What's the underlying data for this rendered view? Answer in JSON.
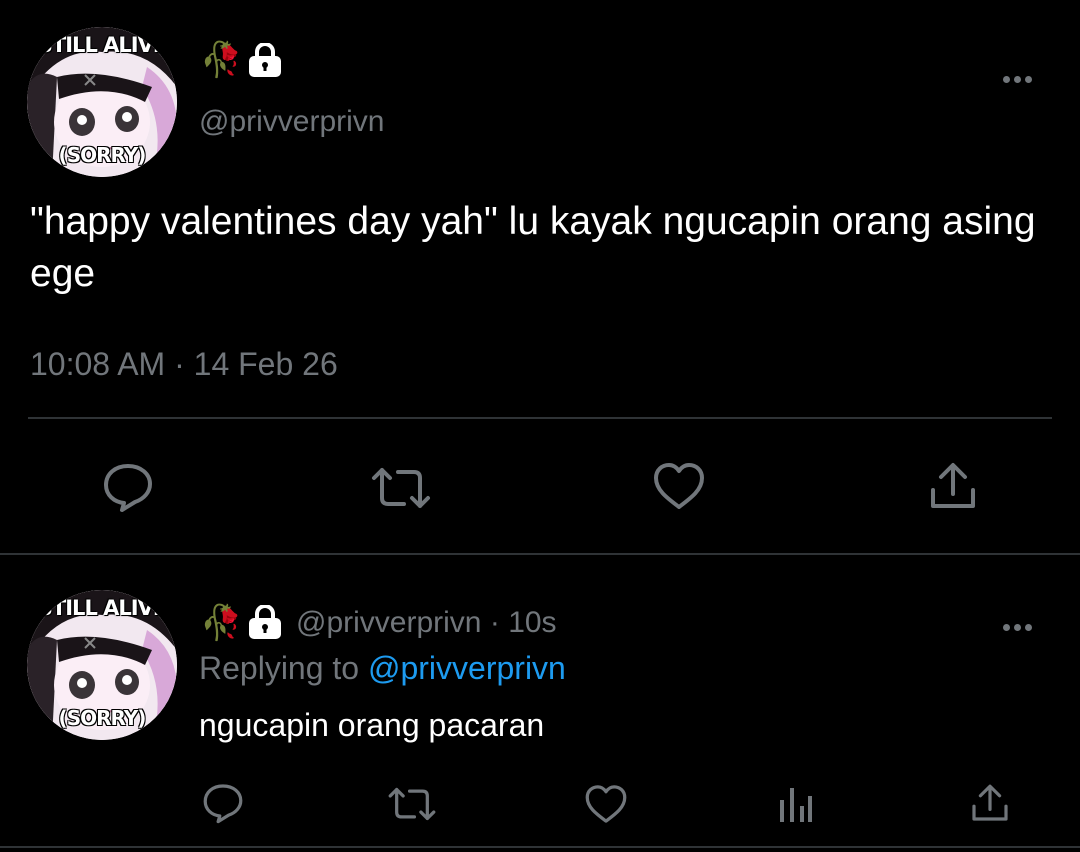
{
  "main_tweet": {
    "avatar": {
      "top_text": "STILL ALIVE",
      "bottom_text": "(SORRY)"
    },
    "emoji": "🥀",
    "handle": "@privverprivn",
    "text": "\"happy valentines day yah\" lu kayak ngucapin orang asing ege",
    "time": "10:08 AM",
    "separator": "·",
    "date": "14 Feb 26",
    "actions": [
      "reply-icon",
      "retweet-icon",
      "like-icon",
      "share-icon"
    ]
  },
  "reply_tweet": {
    "avatar": {
      "top_text": "STILL ALIVE",
      "bottom_text": "(SORRY)"
    },
    "emoji": "🥀",
    "handle": "@privverprivn",
    "separator": "·",
    "age": "10s",
    "replying_prefix": "Replying to",
    "replying_to": "@privverprivn",
    "text": "ngucapin orang pacaran",
    "actions": [
      "reply-icon",
      "retweet-icon",
      "like-icon",
      "analytics-icon",
      "share-icon"
    ]
  },
  "colors": {
    "background": "#000000",
    "text": "#ffffff",
    "muted": "#71767b",
    "link": "#1d9bf0",
    "divider": "#2f3336"
  }
}
